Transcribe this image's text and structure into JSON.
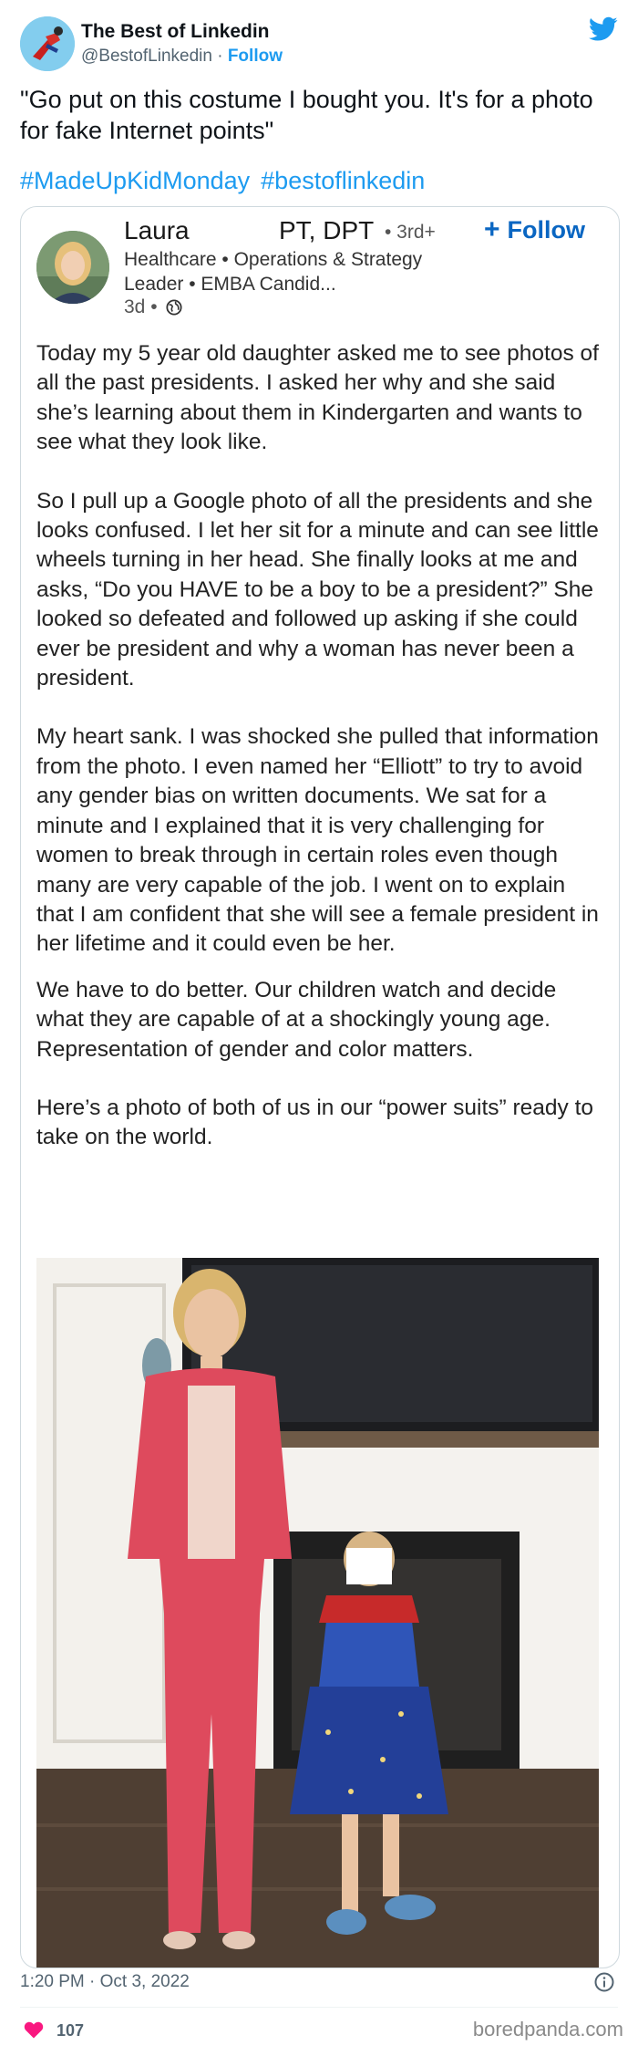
{
  "tweet": {
    "account_name": "The Best of Linkedin",
    "handle": "@BestofLinkedin",
    "separator": " · ",
    "follow_label": "Follow",
    "text": "\"Go put on this costume I bought you. It's for a photo for fake Internet points\"",
    "hashtags": [
      "#MadeUpKidMonday",
      "#bestoflinkedin"
    ],
    "timestamp": "1:20 PM · Oct 3, 2022",
    "like_count": "107",
    "icons": {
      "logo": "twitter-bird-icon",
      "info": "info-icon",
      "like": "heart-icon"
    },
    "colors": {
      "brand_blue": "#1d9bf0",
      "like_red": "#f91880"
    }
  },
  "linkedin_post": {
    "author_name": "Laura",
    "credentials": "PT, DPT",
    "degree": "• 3rd+",
    "follow_label": "Follow",
    "headline": "Healthcare • Operations & Strategy Leader • EMBA Candid...",
    "post_age": "3d •",
    "visibility_icon": "globe-icon",
    "paragraphs": [
      "Today my 5 year old daughter asked me to see photos of all the past presidents. I asked her why and she said she’s learning about them in Kindergarten and wants to see what they look like.",
      "So I pull up a Google photo of all the presidents and she looks confused. I let her sit for a minute and can see little wheels turning in her head. She finally looks at me and asks, “Do you HAVE to be a boy to be a president?” She looked so defeated and followed up asking if she could ever be president and why a woman has never been a president.",
      "My heart sank. I was shocked she pulled that information from the photo. I even named her “Elliott” to try to avoid any gender bias on written documents. We sat for a minute and I explained that it is very challenging for women to break through in certain roles even though many are very capable of the job. I went on to explain that I am confident that she will see a female president in her lifetime and it could even be her.",
      "We have to do better. Our children watch and decide what they are capable of at a shockingly young age. Representation of gender and color matters.",
      "Here’s a photo of both of us in our “power suits” ready to take on the world."
    ],
    "colors": {
      "linkedin_blue": "#0a66c2"
    }
  },
  "watermark": "boredpanda.com"
}
